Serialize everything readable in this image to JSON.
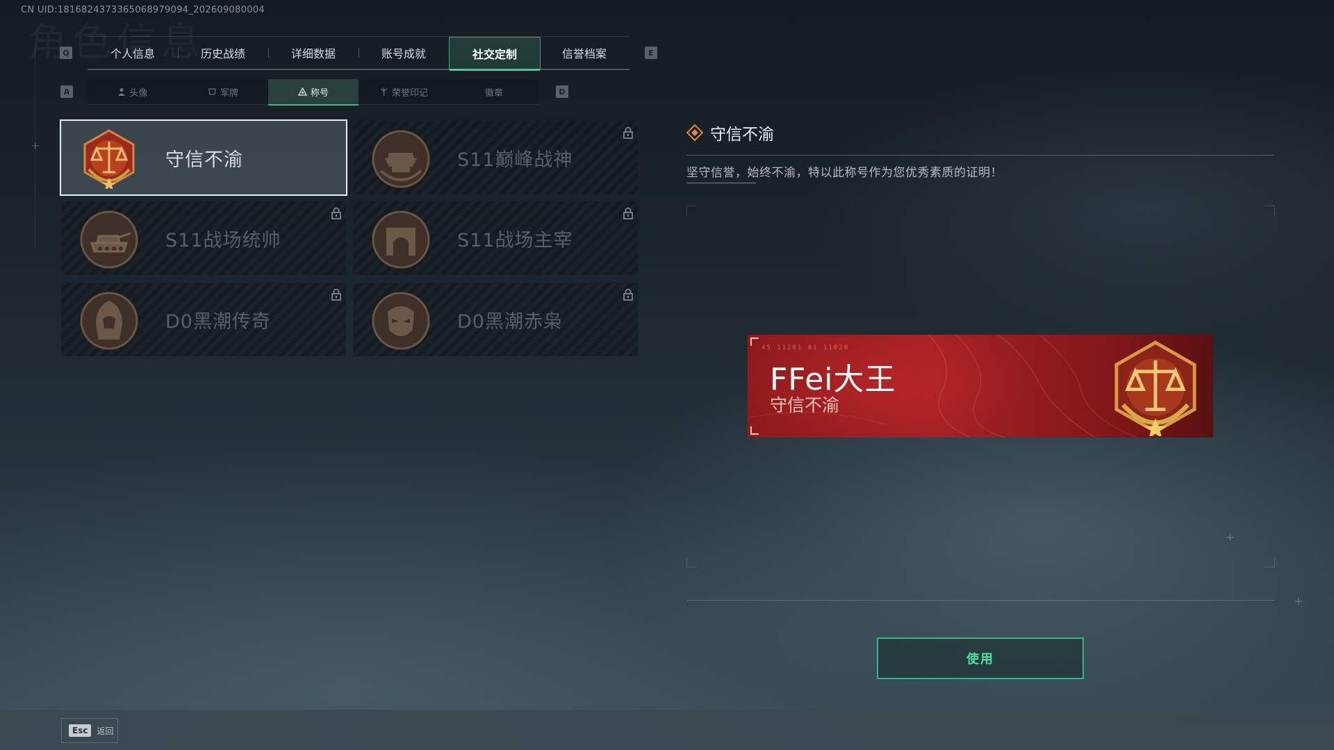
{
  "uid": "CN UID:1816824373365068979094_202609080004",
  "bg_title": "角色信息",
  "tabs": {
    "left_key": "Q",
    "right_key": "E",
    "items": [
      "个人信息",
      "历史战绩",
      "详细数据",
      "账号成就",
      "社交定制",
      "信誉档案"
    ],
    "active": 4
  },
  "subtabs": {
    "left_key": "A",
    "right_key": "D",
    "items": [
      {
        "label": "头像",
        "icon": "person-icon"
      },
      {
        "label": "军牌",
        "icon": "dogtag-icon"
      },
      {
        "label": "称号",
        "icon": "title-icon"
      },
      {
        "label": "荣誉印记",
        "icon": "honor-mark-icon"
      },
      {
        "label": "徽章",
        "icon": ""
      }
    ],
    "active": 2
  },
  "titles": [
    {
      "name": "守信不渝",
      "icon": "scales-medal-icon",
      "locked": false,
      "selected": true
    },
    {
      "name": "S11巅峰战神",
      "icon": "anvil-medal-icon",
      "locked": true,
      "selected": false
    },
    {
      "name": "S11战场统帅",
      "icon": "tank-medal-icon",
      "locked": true,
      "selected": false
    },
    {
      "name": "S11战场主宰",
      "icon": "arch-medal-icon",
      "locked": true,
      "selected": false
    },
    {
      "name": "D0黑潮传奇",
      "icon": "hooded-figure-medal-icon",
      "locked": true,
      "selected": false
    },
    {
      "name": "D0黑潮赤枭",
      "icon": "mask-medal-icon",
      "locked": true,
      "selected": false
    }
  ],
  "detail": {
    "title": "守信不渝",
    "description": "坚守信誉，始终不渝，特以此称号作为您优秀素质的证明！"
  },
  "preview": {
    "player_name": "FFei大王",
    "title": "守信不渝",
    "code": "45 11201  01 11020",
    "colors": {
      "base": "#9a1e21",
      "accent": "#c9722e"
    }
  },
  "use_button": "使用",
  "footer": {
    "key": "Esc",
    "label": "返回"
  },
  "colors": {
    "accent": "#35d39a",
    "active_tab_bg": "#2f5e50"
  }
}
